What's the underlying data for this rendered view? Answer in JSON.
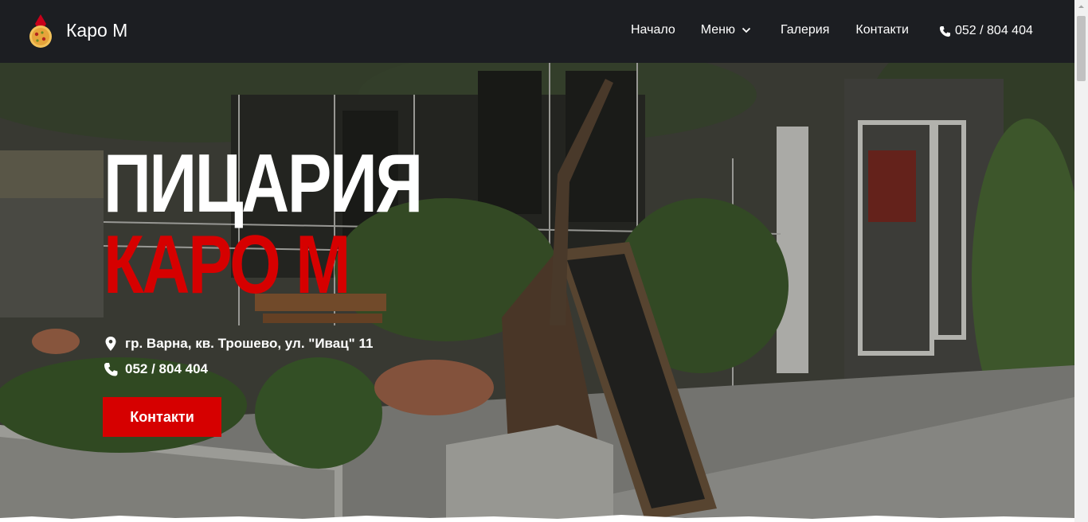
{
  "brand": {
    "name": "Каро М",
    "logo_icon": "pizza-logo-icon"
  },
  "nav": {
    "items": [
      {
        "label": "Начало"
      },
      {
        "label": "Меню",
        "dropdown": true
      },
      {
        "label": "Галерия"
      },
      {
        "label": "Контакти"
      }
    ],
    "phone": "052 / 804 404"
  },
  "hero": {
    "title_line1": "ПИЦАРИЯ",
    "title_line2": "КАРО М",
    "address": "гр. Варна, кв. Трошево, ул. \"Ивац\" 11",
    "phone": "052 / 804 404",
    "button_label": "Контакти"
  },
  "colors": {
    "accent": "#d60000",
    "header_bg": "#1c1e22",
    "text": "#ffffff"
  }
}
